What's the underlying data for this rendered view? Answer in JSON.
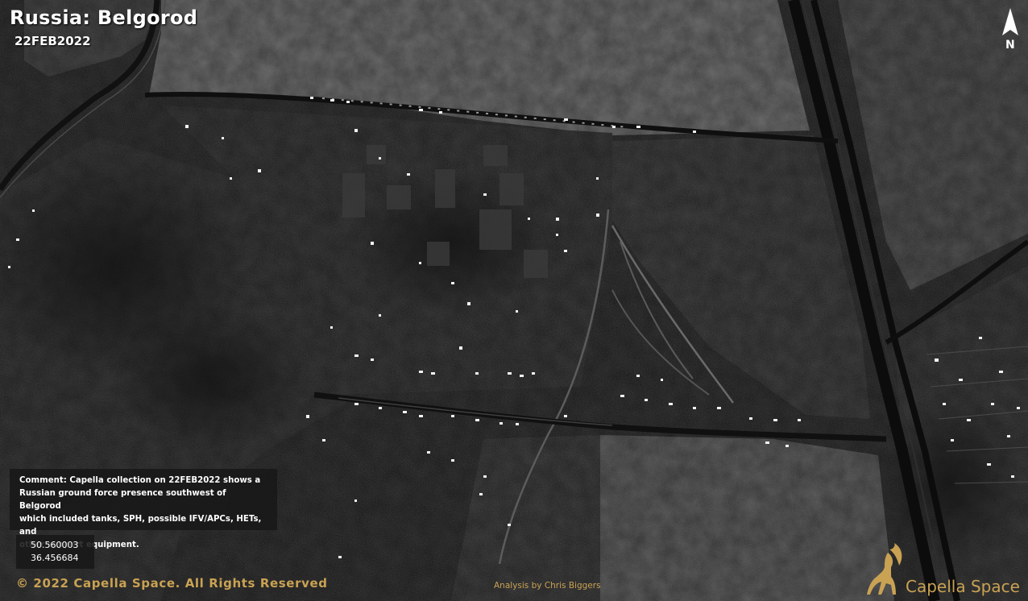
{
  "header": {
    "title": "Russia: Belgorod",
    "date": "22FEB2022"
  },
  "compass": {
    "label": "N",
    "icon": "north-arrow-icon"
  },
  "comment": {
    "lines": [
      "Comment: Capella collection on 22FEB2022 shows a",
      "Russian ground force presence  southwest of Belgorod",
      "which included tanks, SPH, possible IFV/APCs, HETs, and",
      "other support equipment."
    ]
  },
  "coordinates": {
    "latitude": "50.560003",
    "longitude": "36.456684"
  },
  "footer": {
    "copyright": "© 2022 Capella Space. All Rights Reserved",
    "analysis": "Analysis by Chris Biggers",
    "logo_text": "Capella Space",
    "logo_icon": "ibex-logo-icon"
  },
  "colors": {
    "accent": "#c9a253",
    "panel": "#181818",
    "imagery": "#1c1c1c"
  }
}
